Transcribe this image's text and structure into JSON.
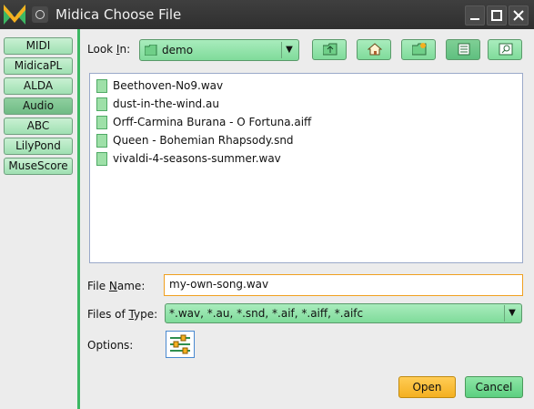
{
  "window": {
    "title": "Midica Choose File"
  },
  "sidebar": {
    "items": [
      {
        "label": "MIDI",
        "active": false
      },
      {
        "label": "MidicaPL",
        "active": false
      },
      {
        "label": "ALDA",
        "active": false
      },
      {
        "label": "Audio",
        "active": true
      },
      {
        "label": "ABC",
        "active": false
      },
      {
        "label": "LilyPond",
        "active": false
      },
      {
        "label": "MuseScore",
        "active": false
      }
    ]
  },
  "lookin": {
    "label_pre": "Look ",
    "label_u": "I",
    "label_post": "n:",
    "value": "demo",
    "dropdown_icon": "triangle-down"
  },
  "toolbar": {
    "buttons": [
      {
        "name": "up-folder-button",
        "icon": "folder-up-icon"
      },
      {
        "name": "home-button",
        "icon": "home-icon"
      },
      {
        "name": "new-folder-button",
        "icon": "new-folder-icon"
      },
      {
        "name": "list-view-button",
        "icon": "list-view-icon",
        "active": true
      },
      {
        "name": "details-view-button",
        "icon": "details-view-icon"
      }
    ]
  },
  "files": [
    "Beethoven-No9.wav",
    "dust-in-the-wind.au",
    "Orff-Carmina Burana - O Fortuna.aiff",
    "Queen - Bohemian Rhapsody.snd",
    "vivaldi-4-seasons-summer.wav"
  ],
  "filename": {
    "label_pre": "File ",
    "label_u": "N",
    "label_post": "ame:",
    "value": "my-own-song.wav"
  },
  "filetype": {
    "label_pre": "Files of ",
    "label_u": "T",
    "label_post": "ype:",
    "value": "*.wav, *.au, *.snd, *.aif, *.aiff, *.aifc"
  },
  "options": {
    "label": "Options:",
    "icon": "sliders-icon"
  },
  "buttons": {
    "open": "Open",
    "cancel": "Cancel"
  },
  "colors": {
    "accent_green": "#3cb763",
    "open_orange": "#f4b020",
    "focus_border": "#f0a020"
  }
}
